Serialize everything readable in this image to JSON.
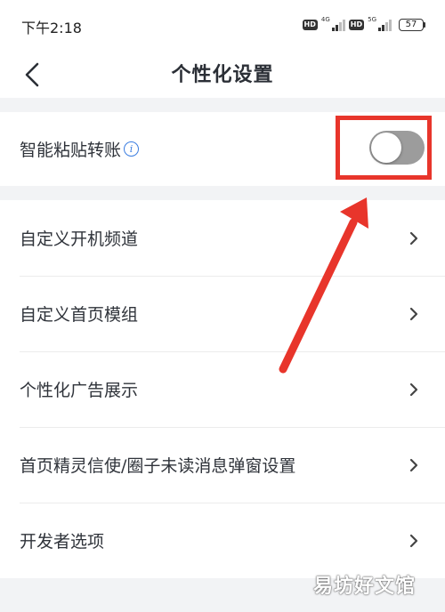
{
  "status_bar": {
    "time": "下午2:18",
    "hd_1": "HD",
    "net_1": "4G",
    "hd_2": "HD",
    "net_2": "5G",
    "battery": "57"
  },
  "nav": {
    "title": "个性化设置",
    "back_icon": "chevron-left-icon"
  },
  "switch_setting": {
    "label": "智能粘贴转账",
    "info_icon": "info-icon",
    "info_glyph": "i",
    "enabled": false
  },
  "menu": [
    {
      "label": "自定义开机频道",
      "icon": "chevron-right-icon"
    },
    {
      "label": "自定义首页模组",
      "icon": "chevron-right-icon"
    },
    {
      "label": "个性化广告展示",
      "icon": "chevron-right-icon"
    },
    {
      "label": "首页精灵信使/圈子未读消息弹窗设置",
      "icon": "chevron-right-icon"
    },
    {
      "label": "开发者选项",
      "icon": "chevron-right-icon"
    }
  ],
  "annotation": {
    "highlight_color": "#e8352b"
  },
  "watermark": "易坊好文馆",
  "colors": {
    "background": "#f2f3f5",
    "card": "#ffffff",
    "toggle_off": "#9c9c9c",
    "info_blue": "#3b7de0"
  }
}
